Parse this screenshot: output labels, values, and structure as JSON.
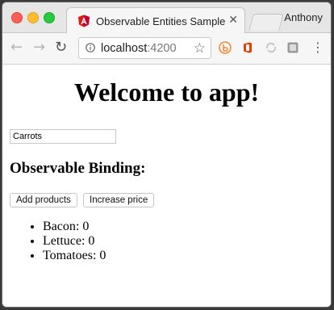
{
  "browser": {
    "tab_title": "Observable Entities Sample",
    "tab_close": "✕",
    "profile_name": "Anthony",
    "url_host": "localhost",
    "url_port": ":4200",
    "icons": {
      "back": "arrow-left-icon",
      "forward": "arrow-right-icon",
      "reload": "reload-icon",
      "info": "info-icon",
      "bookmark": "star-icon",
      "menu": "kebab-menu-icon"
    },
    "colors": {
      "angular_red": "#dd1b16",
      "office_orange": "#eb3c00",
      "ext_orange": "#f08a3c"
    }
  },
  "page": {
    "heading": "Welcome to app!",
    "input_value": "Carrots",
    "subheading": "Observable Binding:",
    "buttons": {
      "add_products": "Add products",
      "increase_price": "Increase price"
    },
    "products": [
      {
        "text": "Bacon: 0"
      },
      {
        "text": "Lettuce: 0"
      },
      {
        "text": "Tomatoes: 0"
      }
    ]
  }
}
